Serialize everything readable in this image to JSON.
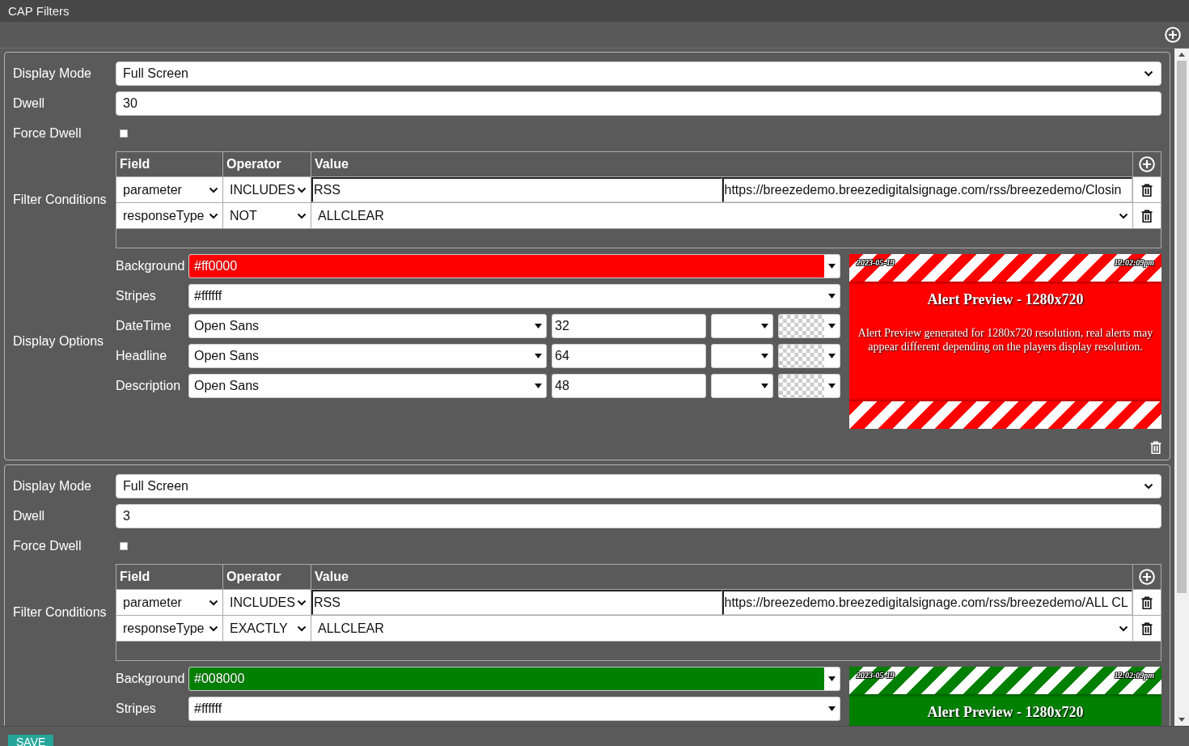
{
  "window": {
    "title": "CAP Filters"
  },
  "filters": [
    {
      "display_mode": {
        "label": "Display Mode",
        "value": "Full Screen"
      },
      "dwell": {
        "label": "Dwell",
        "value": "30"
      },
      "force_dwell": {
        "label": "Force Dwell",
        "checked": false
      },
      "conditions": {
        "label": "Filter Conditions",
        "columns": [
          "Field",
          "Operator",
          "Value"
        ],
        "rows": [
          {
            "kind": "text",
            "field": "parameter",
            "operator": "INCLUDES",
            "values": [
              "RSS",
              "https://breezedemo.breezedigitalsignage.com/rss/breezedemo/Closin"
            ]
          },
          {
            "kind": "select",
            "field": "responseType",
            "operator": "NOT",
            "values": [
              "ALLCLEAR"
            ]
          }
        ]
      },
      "display_options": {
        "label": "Display Options",
        "colors": [
          {
            "label": "Background",
            "value": "#ff0000"
          },
          {
            "label": "Stripes",
            "value": "#ffffff"
          }
        ],
        "fonts": [
          {
            "label": "DateTime",
            "font": "Open Sans",
            "size": "32"
          },
          {
            "label": "Headline",
            "font": "Open Sans",
            "size": "64"
          },
          {
            "label": "Description",
            "font": "Open Sans",
            "size": "48"
          }
        ],
        "preview": {
          "date": "2023-05-19",
          "time": "12:02:09pm",
          "headline": "Alert Preview - 1280x720",
          "description": "Alert Preview generated for 1280x720 resolution, real alerts may appear different depending on the players display resolution."
        }
      }
    },
    {
      "display_mode": {
        "label": "Display Mode",
        "value": "Full Screen"
      },
      "dwell": {
        "label": "Dwell",
        "value": "3"
      },
      "force_dwell": {
        "label": "Force Dwell",
        "checked": false
      },
      "conditions": {
        "label": "Filter Conditions",
        "columns": [
          "Field",
          "Operator",
          "Value"
        ],
        "rows": [
          {
            "kind": "text",
            "field": "parameter",
            "operator": "INCLUDES",
            "values": [
              "RSS",
              "https://breezedemo.breezedigitalsignage.com/rss/breezedemo/ALL CL"
            ]
          },
          {
            "kind": "select",
            "field": "responseType",
            "operator": "EXACTLY",
            "values": [
              "ALLCLEAR"
            ]
          }
        ]
      },
      "display_options": {
        "colors": [
          {
            "label": "Background",
            "value": "#008000"
          },
          {
            "label": "Stripes",
            "value": "#ffffff"
          }
        ],
        "preview": {
          "date": "2023-05-19",
          "time": "12:02:09pm",
          "headline": "Alert Preview - 1280x720"
        }
      }
    }
  ],
  "save_button": {
    "label": "SAVE"
  }
}
